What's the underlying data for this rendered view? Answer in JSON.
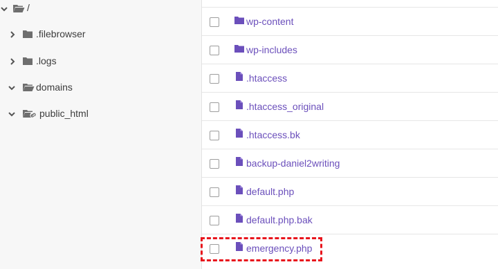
{
  "sidebar": {
    "tree": [
      {
        "label": "/",
        "expanded": true,
        "icon": "folder-open-icon"
      },
      {
        "label": ".filebrowser",
        "expanded": false,
        "icon": "folder-icon"
      },
      {
        "label": ".logs",
        "expanded": false,
        "icon": "folder-icon"
      },
      {
        "label": "domains",
        "expanded": true,
        "icon": "folder-open-icon"
      },
      {
        "label": "public_html",
        "expanded": true,
        "icon": "folder-link-icon"
      }
    ]
  },
  "files": [
    {
      "name": "wp-content",
      "type": "folder"
    },
    {
      "name": "wp-includes",
      "type": "folder"
    },
    {
      "name": ".htaccess",
      "type": "file"
    },
    {
      "name": ".htaccess_original",
      "type": "file"
    },
    {
      "name": ".htaccess.bk",
      "type": "file"
    },
    {
      "name": "backup-daniel2writing",
      "type": "folder"
    },
    {
      "name": "default.php",
      "type": "file"
    },
    {
      "name": "default.php.bak",
      "type": "file"
    },
    {
      "name": "emergency.php",
      "type": "file",
      "highlighted": true
    }
  ],
  "colors": {
    "accent": "#6b4fbb",
    "folder_gray": "#6e6e6e",
    "highlight_red": "#e8141c"
  }
}
